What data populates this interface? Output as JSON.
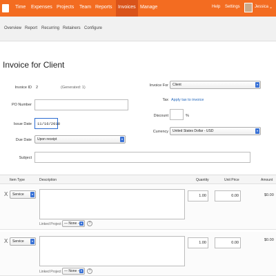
{
  "topnav": {
    "items": [
      "Time",
      "Expenses",
      "Projects",
      "Team",
      "Reports",
      "Invoices",
      "Manage"
    ],
    "active": "Invoices",
    "help": "Help",
    "settings": "Settings",
    "user": "Jessica"
  },
  "subnav": {
    "items": [
      "Overview",
      "Report",
      "Recurring",
      "Retainers",
      "Configure"
    ]
  },
  "page": {
    "title": "Invoice for Client"
  },
  "form": {
    "invoice_id_label": "Invoice ID",
    "invoice_id_value": "2",
    "invoice_id_hint": "(Generated: 1)",
    "po_label": "PO Number",
    "issue_date_label": "Issue Date",
    "issue_date_value": "11/16/2018",
    "due_date_label": "Due Date",
    "due_date_value": "Upon receipt",
    "subject_label": "Subject",
    "invoice_for_label": "Invoice For",
    "invoice_for_value": "Client",
    "tax_label": "Tax",
    "tax_link": "Apply tax to invoice",
    "discount_label": "Discount",
    "discount_unit": "%",
    "currency_label": "Currency",
    "currency_value": "United States Dollar - USD"
  },
  "lines": {
    "headers": {
      "item_type": "Item Type",
      "description": "Description",
      "quantity": "Quantity",
      "unit_price": "Unit Price",
      "amount": "Amount"
    },
    "rows": [
      {
        "remove": "X",
        "type": "Service",
        "quantity": "1.00",
        "unit_price": "0.00",
        "amount": "$0.00",
        "linked_label": "Linked Project",
        "linked_value": "— None —",
        "help": "?"
      },
      {
        "remove": "X",
        "type": "Service",
        "quantity": "1.00",
        "unit_price": "0.00",
        "amount": "$0.00",
        "linked_label": "Linked Project",
        "linked_value": "— None —",
        "help": "?"
      }
    ]
  },
  "colors": {
    "brand": "#f36c21",
    "brand_active": "#d9531a",
    "link": "#2266bb",
    "accent": "#3b73d6"
  }
}
